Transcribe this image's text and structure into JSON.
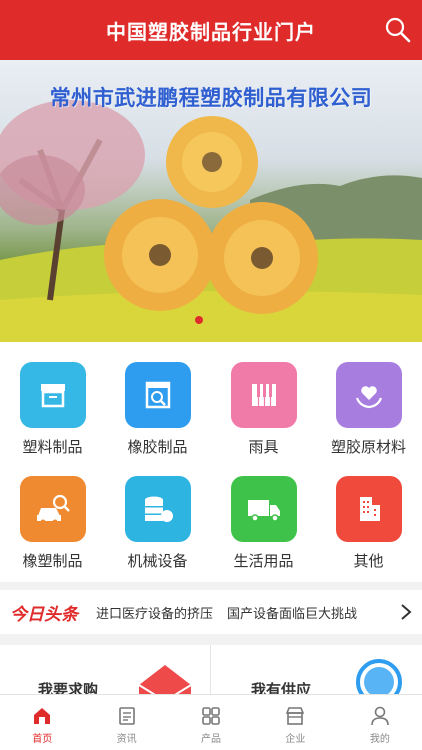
{
  "header": {
    "title": "中国塑胶制品行业门户",
    "search_icon": "search-icon"
  },
  "banner": {
    "caption": "常州市武进鹏程塑胶制品有限公司",
    "slide_total": 1,
    "slide_active": 1
  },
  "categories": [
    {
      "label": "塑料制品",
      "icon": "box-icon",
      "color": "#35b8e6"
    },
    {
      "label": "橡胶制品",
      "icon": "search-box-icon",
      "color": "#2e9df0"
    },
    {
      "label": "雨具",
      "icon": "piano-icon",
      "color": "#f07aa8"
    },
    {
      "label": "塑胶原材料",
      "icon": "heart-hand-icon",
      "color": "#a77ee0"
    },
    {
      "label": "橡塑制品",
      "icon": "car-search-icon",
      "color": "#f08a30"
    },
    {
      "label": "机械设备",
      "icon": "database-icon",
      "color": "#2eb4e0"
    },
    {
      "label": "生活用品",
      "icon": "truck-icon",
      "color": "#3fc24a"
    },
    {
      "label": "其他",
      "icon": "building-icon",
      "color": "#ef4a3c"
    }
  ],
  "news": {
    "tag": "今日头条",
    "items": [
      "进口医疗设备的挤压",
      "国产设备面临巨大挑战"
    ]
  },
  "cards": {
    "left_title": "我要求购",
    "right_title": "我有供应"
  },
  "tabbar": [
    {
      "label": "首页",
      "icon": "home-icon",
      "active": true
    },
    {
      "label": "资讯",
      "icon": "news-icon",
      "active": false
    },
    {
      "label": "产品",
      "icon": "grid-icon",
      "active": false
    },
    {
      "label": "企业",
      "icon": "store-icon",
      "active": false
    },
    {
      "label": "我的",
      "icon": "user-icon",
      "active": false
    }
  ]
}
